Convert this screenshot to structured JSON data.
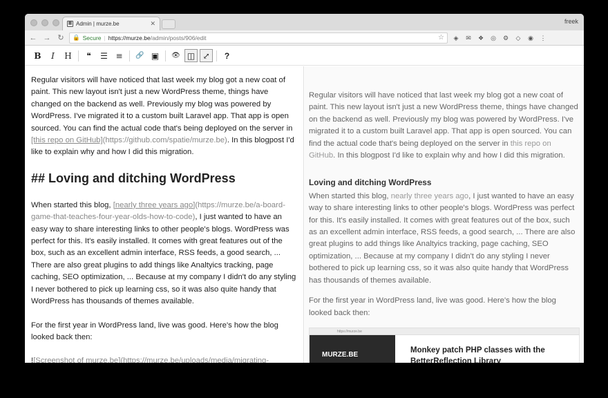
{
  "browser": {
    "tab_title": "Admin | murze.be",
    "profile_name": "freek",
    "secure_label": "Secure",
    "url_host": "https://murze.be",
    "url_path": "/admin/posts/906/edit"
  },
  "editor_toolbar": {
    "buttons": [
      "bold",
      "italic",
      "heading",
      "quote",
      "unordered-list",
      "ordered-list",
      "link",
      "image",
      "preview",
      "side-by-side",
      "fullscreen",
      "guide"
    ],
    "glyphs": {
      "bold": "B",
      "italic": "I",
      "heading": "H",
      "quote": "❝",
      "ul": "☰",
      "ol": "≡",
      "link": "🔗",
      "image": "▣",
      "preview": "👁",
      "side": "◫",
      "full": "⤢",
      "guide": "?"
    }
  },
  "markdown": {
    "p1_text": "Regular visitors will have noticed that last week my blog got a new coat of paint. This new layout isn't just a new WordPress theme, things have changed on the backend as well. Previously my blog was powered by WordPress. I've migrated it to a custom built Laravel app. That app is open sourced. You can find the actual code that's being deployed on the server in ",
    "p1_link_text": "[this repo on GitHub]",
    "p1_link_url": "(https://github.com/spatie/murze.be)",
    "p1_tail": ". In this blogpost I'd like to explain why and how I did this migration.",
    "h2": "## Loving and ditching WordPress",
    "p2_head": "When started this blog, ",
    "p2_link_text": "[nearly three years ago]",
    "p2_link_url": "(https://murze.be/a-board-game-that-teaches-four-year-olds-how-to-code)",
    "p2_tail": ", I just wanted to have an easy way to share interesting links to other people's blogs. WordPress was perfect for this. It's easily installed. It comes with great features out of the box, such as an excellent admin interface, RSS feeds, a good search, ... There are also great plugins to add things like Analtyics tracking, page caching, SEO optimization, ... Because at my company I didn't do any styling I never bothered to pick up learning css, so it was also quite handy that WordPress has thousands of themes available.",
    "p3": "For the first year in WordPress land, live was good. Here's how the blog looked back then:",
    "p4_head": "!",
    "p4_link_text": "[Screenshot of murze.be]",
    "p4_link_url": "(https://murze.be/uploads/media/migrating-"
  },
  "preview": {
    "p1_text": "Regular visitors will have noticed that last week my blog got a new coat of paint. This new layout isn't just a new WordPress theme, things have changed on the backend as well. Previously my blog was powered by WordPress. I've migrated it to a custom built Laravel app. That app is open sourced. You can find the actual code that's being deployed on the server in ",
    "p1_link": "this repo on GitHub",
    "p1_tail": ". In this blogpost I'd like to explain why and how I did this migration.",
    "h3": "Loving and ditching WordPress",
    "p2_head": "When started this blog, ",
    "p2_link": "nearly three years ago",
    "p2_tail": ", I just wanted to have an easy way to share interesting links to other people's blogs. WordPress was perfect for this. It's easily installed. It comes with great features out of the box, such as an excellent admin interface, RSS feeds, a good search, ... There are also great plugins to add things like Analtyics tracking, page caching, SEO optimization, ... Because at my company I didn't do any styling I never bothered to pick up learning css, so it was also quite handy that WordPress has thousands of themes available.",
    "p3": "For the first year in WordPress land, live was good. Here's how the blog looked back then:",
    "image_brand": "MURZE.BE",
    "image_url": "https://murze.be",
    "image_title": "Monkey patch PHP classes with the BetterReflection Library"
  }
}
